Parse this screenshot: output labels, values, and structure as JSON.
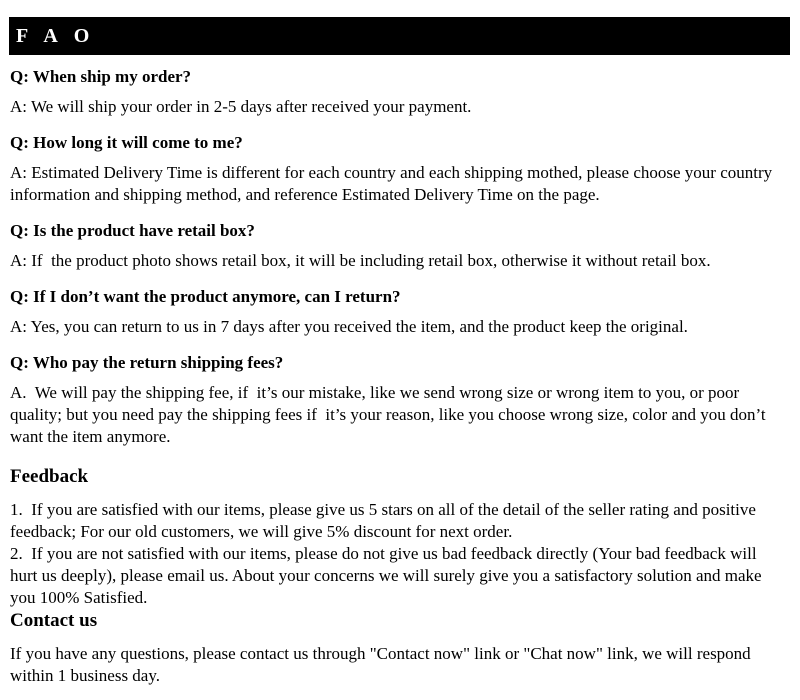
{
  "header": {
    "title": "F A O",
    "background_color": "#000000",
    "text_color": "#ffffff"
  },
  "faq": {
    "items": [
      {
        "question": "Q: When ship my order?",
        "answer": "A: We will ship your order in 2-5 days after received your payment."
      },
      {
        "question": "Q: How long it will come to me?",
        "answer": "A: Estimated Delivery Time is different for each country and each shipping mothed, please choose your country information and shipping method, and reference Estimated Delivery Time on the page."
      },
      {
        "question": "Q: Is the product have retail box?",
        "answer": "A: If  the product photo shows retail box, it will be including retail box, otherwise it without retail box."
      },
      {
        "question": "Q: If I don’t want the product anymore, can I return?",
        "answer": "A: Yes, you can return to us in 7 days after you received the item, and the product keep the original."
      },
      {
        "question": "Q: Who pay the return shipping fees?",
        "answer": "A.  We will pay the shipping fee, if  it’s our mistake, like we send wrong size or wrong item to you, or poor quality; but you need pay the shipping fees if  it’s your reason, like you choose wrong size, color and you don’t want the item anymore."
      }
    ]
  },
  "feedback": {
    "heading": "Feedback",
    "point_1": "1.  If you are satisfied with our items, please give us 5 stars on all of the detail of the seller rating and positive feedback; For our old customers, we will give 5% discount for next order.",
    "point_2": "2.  If you are not satisfied with our items, please do not give us bad feedback directly (Your bad feedback will hurt us deeply), please email us. About your concerns we will surely give you a satisfactory solution and make you 100% Satisfied."
  },
  "contact": {
    "heading": "Contact us",
    "body": "If you have any questions, please contact us through \"Contact now\" link or \"Chat now\" link, we will respond within 1 business day."
  }
}
